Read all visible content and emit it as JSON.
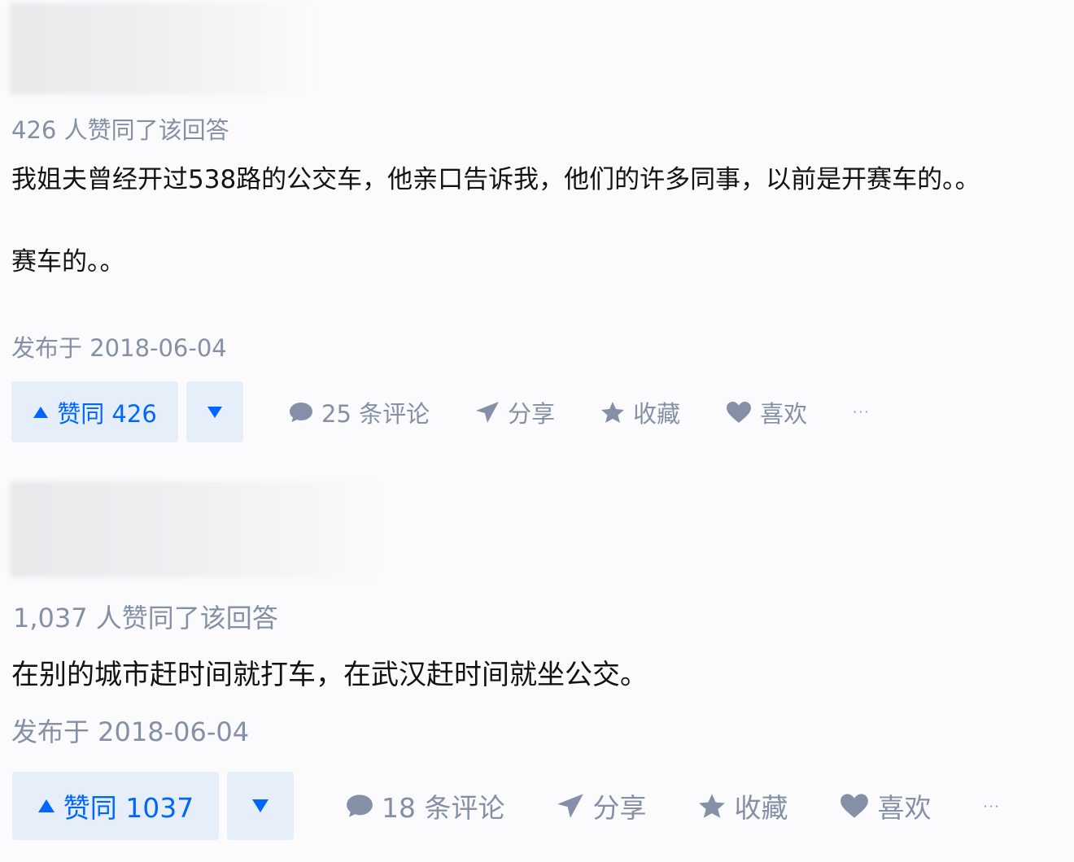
{
  "answers": [
    {
      "votes_text": "426 人赞同了该回答",
      "paragraphs": [
        "我姐夫曾经开过538路的公交车，他亲口告诉我，他们的许多同事，以前是开赛车的。。",
        "赛车的。。"
      ],
      "published": "发布于 2018-06-04",
      "upvote_label": "赞同 426",
      "comments_label": "25 条评论",
      "share_label": "分享",
      "collect_label": "收藏",
      "like_label": "喜欢",
      "more_label": "···"
    },
    {
      "votes_text": "1,037 人赞同了该回答",
      "paragraphs": [
        "在别的城市赶时间就打车，在武汉赶时间就坐公交。"
      ],
      "published": "发布于 2018-06-04",
      "upvote_label": "赞同 1037",
      "comments_label": "18 条评论",
      "share_label": "分享",
      "collect_label": "收藏",
      "like_label": "喜欢",
      "more_label": "···"
    }
  ],
  "icons": {
    "upvote": "triangle-up-icon",
    "downvote": "triangle-down-icon",
    "comment": "comment-bubble-icon",
    "share": "paper-plane-icon",
    "collect": "star-icon",
    "like": "heart-icon",
    "more": "ellipsis-icon"
  },
  "colors": {
    "accent": "#0066ff",
    "vote_button_bg": "#e5eef9",
    "meta_text": "#8590a6",
    "body_text": "#121212"
  }
}
